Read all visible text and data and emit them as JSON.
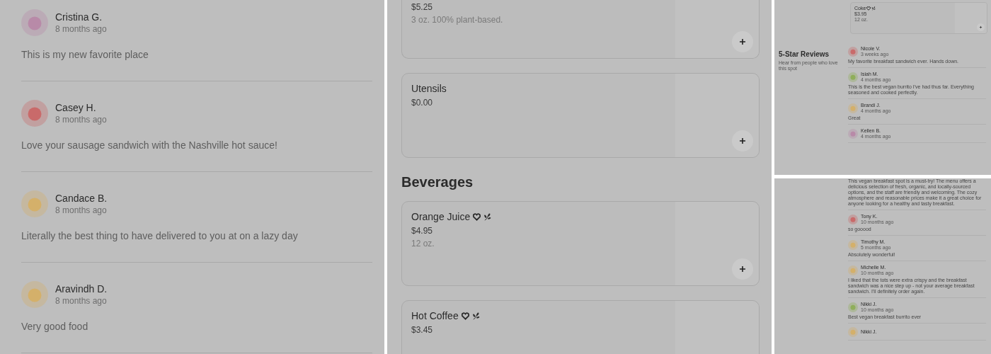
{
  "reviews_panel": {
    "reviews": [
      {
        "name": "Cristina G.",
        "time": "8 months ago",
        "text": "This is my new favorite place",
        "color": "#b88aa8"
      },
      {
        "name": "Casey H.",
        "time": "8 months ago",
        "text": "Love your sausage sandwich with the Nashville hot sauce!",
        "color": "#c96a6a"
      },
      {
        "name": "Candace B.",
        "time": "8 months ago",
        "text": "Literally the best thing to have delivered to you at on a lazy day",
        "color": "#d4b06a"
      },
      {
        "name": "Aravindh D.",
        "time": "8 months ago",
        "text": "Very good food",
        "color": "#d4b06a"
      }
    ]
  },
  "menu_panel": {
    "sections": [
      {
        "items": [
          {
            "price": "$5.25",
            "description": "3 oz. 100% plant-based."
          },
          {
            "name": "Utensils",
            "price": "$0.00",
            "popular": false,
            "vegan": false
          }
        ]
      },
      {
        "heading": "Beverages",
        "items": [
          {
            "name": "Orange Juice",
            "price": "$4.95",
            "description": "12 oz.",
            "popular": true,
            "vegan": true
          },
          {
            "name": "Hot Coffee",
            "price": "$3.45",
            "popular": true,
            "vegan": true
          }
        ]
      }
    ]
  },
  "reviews_page": {
    "menu_item": {
      "name": "Coke",
      "price": "$3.95",
      "description": "12 oz.",
      "popular": true,
      "vegan": true
    },
    "title": "5-Star Reviews",
    "subtitle": "Hear from people who love this spot",
    "reviews": [
      {
        "name": "Nicole V.",
        "time": "3 weeks ago",
        "text": "My favorite breakfast sandwich ever. Hands down.",
        "color": "#c96a6a"
      },
      {
        "name": "Isiah M.",
        "time": "4 months ago",
        "text": "This is the best vegan burrito I've had thus far. Everything seasoned and cooked perfectly.",
        "color": "#8fae5a"
      },
      {
        "name": "Brandi J.",
        "time": "4 months ago",
        "text": "Great",
        "color": "#d4b06a"
      },
      {
        "name": "Kellen B.",
        "time": "4 months ago",
        "color": "#b88aa8"
      }
    ]
  },
  "reviews_page_continued": {
    "reviews": [
      {
        "text": "This vegan breakfast spot is a must-try! The menu offers a delicious selection of fresh, organic, and locally-sourced options, and the staff are friendly and welcoming. The cozy atmosphere and reasonable prices make it a great choice for anyone looking for a healthy and tasty breakfast."
      },
      {
        "name": "Tony K.",
        "time": "10 months ago",
        "text": "so gooood",
        "color": "#c96a6a"
      },
      {
        "name": "Timothy M.",
        "time": "5 months ago",
        "text": "Absolutely wonderful!",
        "color": "#d4b06a"
      },
      {
        "name": "Michelle M.",
        "time": "10 months ago",
        "text": "I liked that the tots were extra crispy and the breakfast sandwich was a nice step up - not your average breakfast sandwich. I'll definitely order again.",
        "color": "#d4b06a"
      },
      {
        "name": "Nikki J.",
        "time": "10 months ago",
        "text": "Best vegan breakfast burrito ever",
        "color": "#8fae5a"
      },
      {
        "name": "Nikki J.",
        "color": "#d4b06a"
      }
    ]
  }
}
